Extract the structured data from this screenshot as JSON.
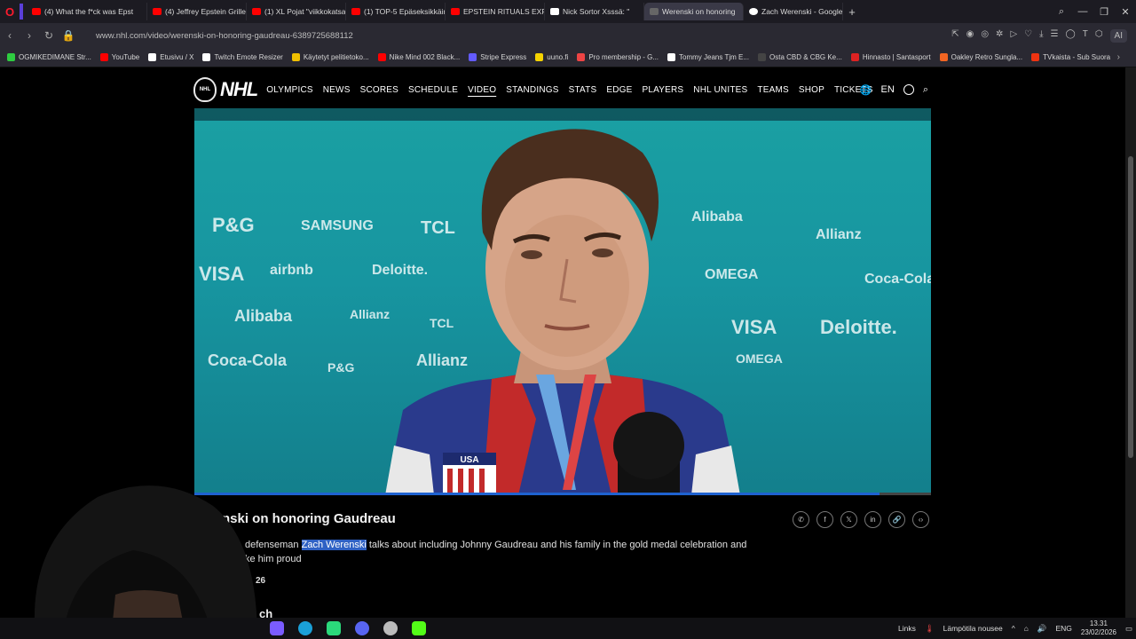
{
  "browser": {
    "tabs": [
      {
        "label": "(4) What the f*ck was Epst",
        "color": "#ff0000",
        "active": false
      },
      {
        "label": "(4) Jeffrey Epstein Grilled",
        "color": "#ff0000",
        "active": false
      },
      {
        "label": "(1) XL Pojat \"viikkokatsau",
        "color": "#ff0000",
        "active": false
      },
      {
        "label": "(1) TOP-5 Epäseksikkäimm",
        "color": "#ff0000",
        "active": false
      },
      {
        "label": "EPSTEIN RITUALS EXPOSE",
        "color": "#ff0000",
        "active": false
      },
      {
        "label": "Nick Sortor Xsssä: \"",
        "color": "#ffffff",
        "active": false
      },
      {
        "label": "Werenski on honoring",
        "color": "#666666",
        "active": true
      },
      {
        "label": "Zach Werenski - Google-h",
        "color": "#ffffff",
        "active": false
      }
    ],
    "url": "www.nhl.com/video/werenski-on-honoring-gaudreau-6389725688112",
    "ai_label": "AI",
    "bookmarks": [
      {
        "label": "OGMIKEDIMANE Str...",
        "color": "#2ecc40"
      },
      {
        "label": "YouTube",
        "color": "#ff0000"
      },
      {
        "label": "Etusivu / X",
        "color": "#ffffff"
      },
      {
        "label": "Twitch Emote Resizer",
        "color": "#ffffff"
      },
      {
        "label": "Käytetyt pelitietoko...",
        "color": "#f0c000"
      },
      {
        "label": "Nike Mind 002 Black...",
        "color": "#ff0000"
      },
      {
        "label": "Stripe Express",
        "color": "#635bff"
      },
      {
        "label": "uuno.fi",
        "color": "#f5d300"
      },
      {
        "label": "Pro membership - G...",
        "color": "#e44"
      },
      {
        "label": "Tommy Jeans Tjm E...",
        "color": "#ffffff"
      },
      {
        "label": "Osta CBD & CBG Ke...",
        "color": "#444444"
      },
      {
        "label": "Hinnasto | Santasport",
        "color": "#d22"
      },
      {
        "label": "Oakley Retro Sungla...",
        "color": "#f26522"
      },
      {
        "label": "TVkaista - Sub Suora",
        "color": "#e31"
      }
    ]
  },
  "nhl": {
    "logo_text": "NHL",
    "nav": [
      "OLYMPICS",
      "NEWS",
      "SCORES",
      "SCHEDULE",
      "VIDEO",
      "STANDINGS",
      "STATS",
      "EDGE",
      "PLAYERS",
      "NHL UNITES",
      "TEAMS",
      "SHOP",
      "TICKETS"
    ],
    "active_nav": "VIDEO",
    "language": "EN"
  },
  "video": {
    "title_visible": "nski on honoring Gaudreau",
    "desc_before": "defenseman ",
    "desc_highlight": "Zach Werenski",
    "desc_after": " talks about including Johnny Gaudreau and his family in the gold medal celebration and",
    "desc_line2": "ke him proud",
    "date_fragment": "26",
    "watch_fragment": "ch",
    "jersey_text": "USA",
    "progress": 0.93,
    "sponsors": [
      "P&G",
      "SAMSUNG",
      "TCL",
      "Alibaba",
      "Allianz",
      "VISA",
      "airbnb",
      "Deloitte.",
      "OMEGA",
      "Coca-Cola",
      "Alibaba",
      "Allianz",
      "TCL",
      "VISA",
      "Deloitte.",
      "Coca-Cola",
      "P&G",
      "Allianz",
      "OMEGA"
    ]
  },
  "taskbar": {
    "links_label": "Links",
    "weather": "Lämpötila nousee",
    "language": "ENG",
    "time": "13.31",
    "date": "23/02/2026"
  }
}
